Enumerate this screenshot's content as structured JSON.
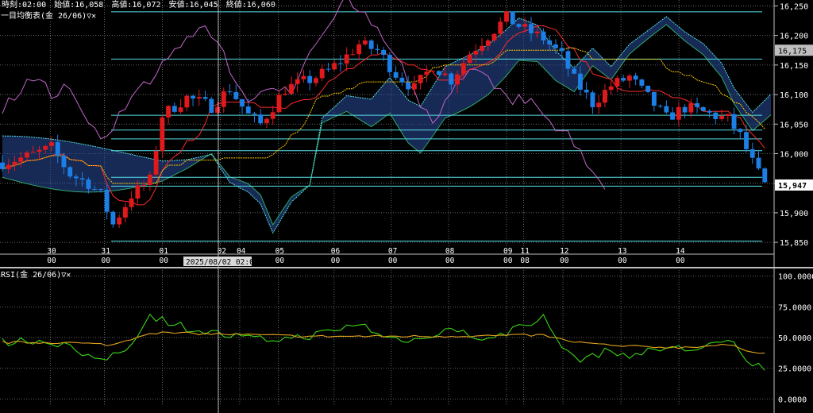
{
  "header": {
    "time": "時刻:02:00",
    "open": "始値:16,058",
    "high": "高値:16,072",
    "low": "安値:16,045",
    "close": "終値:16,060"
  },
  "panels": {
    "main_label": "一目均衡表(金 26/06)▽✕",
    "rsi_label": "RSI(金 26/06)▽✕"
  },
  "cursor_label": "2025/08/02 02:00",
  "colors": {
    "background": "#000000",
    "grid": "#7f7f7f",
    "candle_up": "#e0191d",
    "candle_down": "#1c7fe6",
    "kumo_line": "#2fa86a",
    "kumo_fill": "#2a4a9a",
    "tenkan": "#ff2a2a",
    "kijun": "#ffcc00",
    "chikou": "#c066c8",
    "hline": "#56e0e6",
    "rsi": "#39d414",
    "rsi_signal": "#e0a31c"
  },
  "chart_data": [
    {
      "type": "candlestick",
      "title": "一目均衡表(金 26/06)",
      "ylim": [
        15830,
        16260
      ],
      "y_ticks": [
        "16,250",
        "16,200",
        "16,150",
        "16,100",
        "16,050",
        "16,000",
        "15,950",
        "15,900",
        "15,850"
      ],
      "y_tick_values": [
        16250,
        16200,
        16150,
        16100,
        16050,
        16000,
        15950,
        15900,
        15850
      ],
      "x_ticks": [
        {
          "day": "30",
          "hour": "00"
        },
        {
          "day": "31",
          "hour": "00"
        },
        {
          "day": "01",
          "hour": "00"
        },
        {
          "day": "02",
          "hour": "00"
        },
        {
          "day": "04",
          "hour": ""
        },
        {
          "day": "05",
          "hour": "00"
        },
        {
          "day": "06",
          "hour": "00"
        },
        {
          "day": "07",
          "hour": "00"
        },
        {
          "day": "08",
          "hour": "00"
        },
        {
          "day": "09",
          "hour": "00"
        },
        {
          "day": "11",
          "hour": "08"
        },
        {
          "day": "12",
          "hour": "00"
        },
        {
          "day": "13",
          "hour": "00"
        },
        {
          "day": "14",
          "hour": "00"
        }
      ],
      "x_tick_positions": [
        0.065,
        0.135,
        0.21,
        0.285,
        0.31,
        0.36,
        0.432,
        0.506,
        0.58,
        0.655,
        0.677,
        0.728,
        0.803,
        0.878
      ],
      "price_labels": [
        {
          "value": 16175,
          "label": "16,175"
        },
        {
          "value": 15947,
          "label": "15,947"
        }
      ],
      "horizontal_levels": [
        16240,
        16160,
        16065,
        16040,
        16025,
        16005,
        15960,
        15945,
        15852
      ],
      "close_path": [
        [
          0,
          15985
        ],
        [
          4,
          15995
        ],
        [
          8,
          16010
        ],
        [
          11,
          15965
        ],
        [
          14,
          15950
        ],
        [
          16,
          15930
        ],
        [
          18,
          15880
        ],
        [
          21,
          15930
        ],
        [
          24,
          15955
        ],
        [
          26,
          16065
        ],
        [
          30,
          16095
        ],
        [
          34,
          16080
        ],
        [
          37,
          16110
        ],
        [
          40,
          16065
        ],
        [
          42,
          16050
        ],
        [
          46,
          16110
        ],
        [
          50,
          16125
        ],
        [
          53,
          16140
        ],
        [
          56,
          16165
        ],
        [
          58,
          16185
        ],
        [
          61,
          16175
        ],
        [
          64,
          16135
        ],
        [
          67,
          16110
        ],
        [
          70,
          16150
        ],
        [
          73,
          16125
        ],
        [
          76,
          16170
        ],
        [
          79,
          16200
        ],
        [
          82,
          16230
        ],
        [
          85,
          16210
        ],
        [
          88,
          16195
        ],
        [
          91,
          16165
        ],
        [
          93,
          16125
        ],
        [
          96,
          16085
        ],
        [
          99,
          16115
        ],
        [
          102,
          16130
        ],
        [
          105,
          16095
        ],
        [
          108,
          16060
        ],
        [
          111,
          16078
        ],
        [
          114,
          16070
        ],
        [
          118,
          16058
        ],
        [
          120,
          16030
        ],
        [
          122,
          15985
        ],
        [
          124,
          15947
        ]
      ]
    },
    {
      "type": "line",
      "title": "RSI(金 26/06)",
      "ylim": [
        -5,
        105
      ],
      "y_ticks": [
        "100.0000",
        "75.0000",
        "50.0000",
        "25.0000",
        "0.0000"
      ],
      "y_tick_values": [
        100,
        75,
        50,
        25,
        0
      ],
      "series": [
        {
          "name": "RSI",
          "values": [
            [
              0,
              46
            ],
            [
              5,
              48
            ],
            [
              10,
              45
            ],
            [
              15,
              30
            ],
            [
              20,
              40
            ],
            [
              24,
              68
            ],
            [
              30,
              58
            ],
            [
              36,
              52
            ],
            [
              42,
              48
            ],
            [
              48,
              50
            ],
            [
              54,
              55
            ],
            [
              58,
              62
            ],
            [
              62,
              50
            ],
            [
              68,
              48
            ],
            [
              72,
              58
            ],
            [
              76,
              52
            ],
            [
              80,
              48
            ],
            [
              84,
              60
            ],
            [
              88,
              66
            ],
            [
              90,
              50
            ],
            [
              93,
              32
            ],
            [
              98,
              38
            ],
            [
              103,
              36
            ],
            [
              108,
              42
            ],
            [
              112,
              40
            ],
            [
              116,
              46
            ],
            [
              119,
              44
            ],
            [
              121,
              30
            ],
            [
              124,
              25
            ]
          ]
        },
        {
          "name": "Signal",
          "values": [
            [
              0,
              46
            ],
            [
              10,
              46
            ],
            [
              18,
              44
            ],
            [
              24,
              54
            ],
            [
              34,
              53
            ],
            [
              50,
              51
            ],
            [
              70,
              51
            ],
            [
              88,
              52
            ],
            [
              92,
              47
            ],
            [
              100,
              43
            ],
            [
              110,
              42
            ],
            [
              118,
              44
            ],
            [
              121,
              40
            ],
            [
              124,
              37
            ]
          ]
        }
      ]
    }
  ]
}
